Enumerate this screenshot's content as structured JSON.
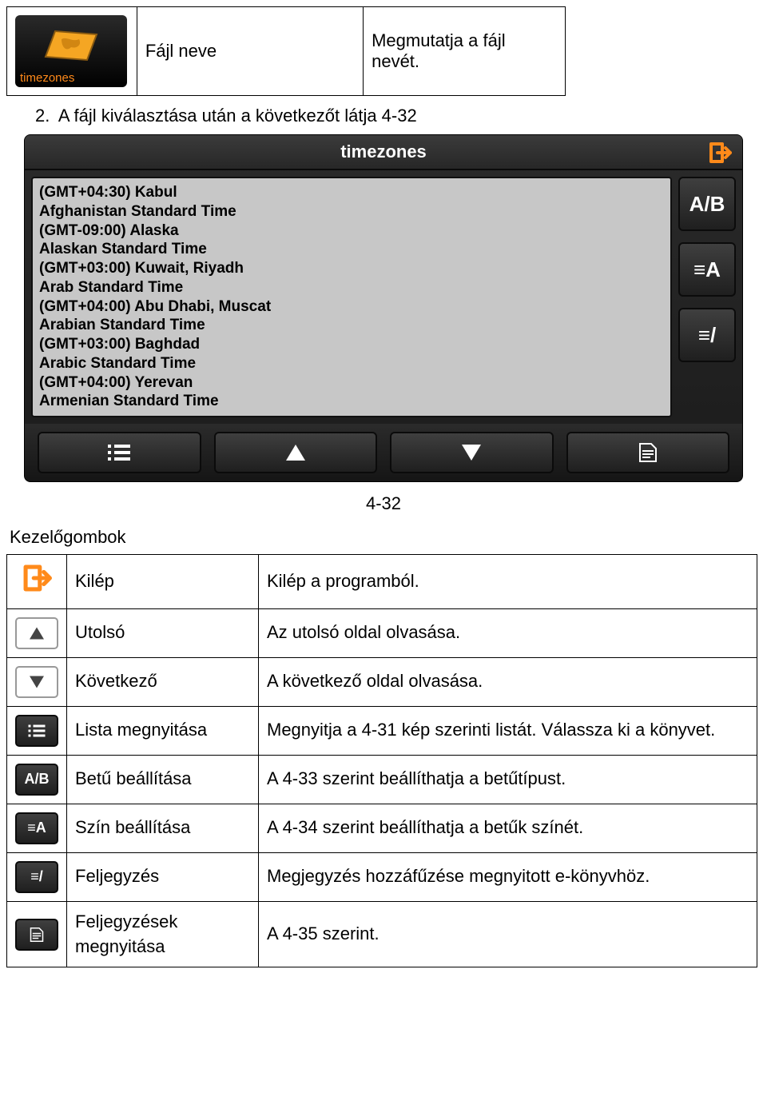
{
  "top_row": {
    "icon_caption": "timezones",
    "col2": "Fájl neve",
    "col3": "Megmutatja a fájl nevét."
  },
  "intro": {
    "num": "2.",
    "text": "A fájl kiválasztása után a következőt látja 4-32"
  },
  "screenshot": {
    "title": "timezones",
    "lines": [
      "(GMT+04:30) Kabul",
      "Afghanistan Standard Time",
      "(GMT-09:00) Alaska",
      "Alaskan Standard Time",
      "(GMT+03:00) Kuwait, Riyadh",
      "Arab Standard Time",
      "(GMT+04:00) Abu Dhabi, Muscat",
      "Arabian Standard Time",
      "(GMT+03:00) Baghdad",
      "Arabic Standard Time",
      "(GMT+04:00) Yerevan",
      "Armenian Standard Time"
    ],
    "side_labels": {
      "ab": "A/B",
      "ea": "≡A",
      "ep": "≡/"
    }
  },
  "figure_label": "4-32",
  "kg_heading": "Kezelőgombok",
  "buttons": [
    {
      "name": "Kilép",
      "desc": "Kilép a programból."
    },
    {
      "name": "Utolsó",
      "desc": "Az utolsó oldal olvasása."
    },
    {
      "name": "Következő",
      "desc": "A következő oldal olvasása."
    },
    {
      "name": "Lista megnyitása",
      "desc": "Megnyitja a 4-31 kép szerinti listát. Válassza ki a könyvet."
    },
    {
      "name": "Betű beállítása",
      "desc": "A 4-33 szerint beállíthatja a betűtípust."
    },
    {
      "name": "Szín beállítása",
      "desc": "A 4-34 szerint beállíthatja a betűk színét."
    },
    {
      "name": "Feljegyzés",
      "desc": "Megjegyzés hozzáfűzése megnyitott e-könyvhöz."
    },
    {
      "name": "Feljegyzések megnyitása",
      "desc": "A 4-35 szerint."
    }
  ]
}
